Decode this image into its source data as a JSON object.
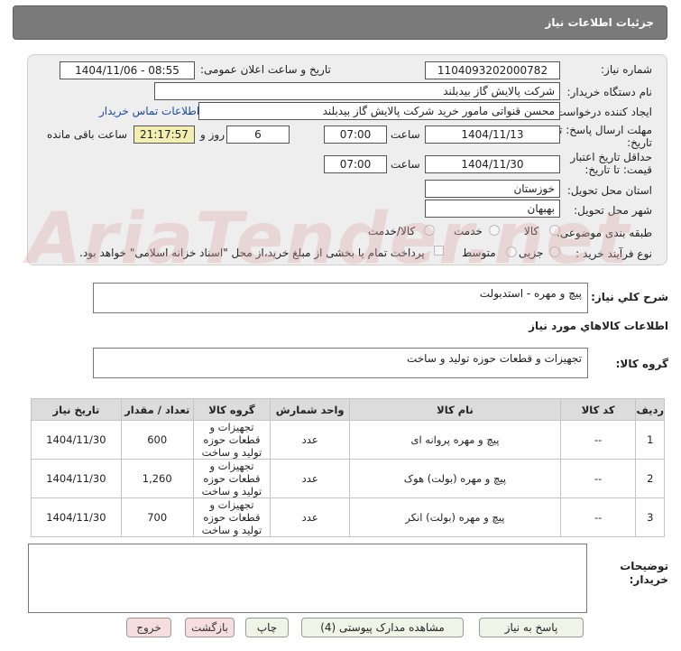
{
  "header": {
    "title": "جزئیات اطلاعات نیاز"
  },
  "form": {
    "need_number_label": "شماره نیاز:",
    "need_number": "1104093202000782",
    "announce_label": "تاریخ و ساعت اعلان عمومی:",
    "announce_value": "1404/11/06 - 08:55",
    "buyer_org_label": "نام دستگاه خریدار:",
    "buyer_org": "شرکت پالایش گاز بیدبلند",
    "creator_label": "ایجاد کننده درخواست:",
    "creator": "محسن قنواتی مامور خرید شرکت پالایش گاز بیدبلند",
    "contact_link": "اطلاعات تماس خریدار",
    "deadline_label_1": "مهلت ارسال پاسخ: تا",
    "deadline_label_2": "تاریخ:",
    "deadline_date": "1404/11/13",
    "time_label": "ساعت",
    "deadline_time": "07:00",
    "days_value": "6",
    "days_label": "روز و",
    "remaining_time": "21:17:57",
    "remaining_label": "ساعت باقی مانده",
    "validity_label_1": "حداقل تاریخ اعتبار",
    "validity_label_2": "قیمت: تا تاریخ:",
    "validity_date": "1404/11/30",
    "validity_time": "07:00",
    "province_label": "استان محل تحویل:",
    "province": "خوزستان",
    "city_label": "شهر محل تحویل:",
    "city": "بهبهان",
    "category_label": "طبقه بندی موضوعی:",
    "category_options": [
      "کالا",
      "خدمت",
      "کالا/خدمت"
    ],
    "process_label": "نوع فرآیند خرید :",
    "process_options": [
      "جزیی",
      "متوسط"
    ],
    "payment_note": "پرداخت تمام یا بخشی از مبلغ خرید،از محل \"اسناد خزانه اسلامی\" خواهد بود."
  },
  "description": {
    "label": "شرح کلي نياز:",
    "value": "پیچ و مهره - استدبولت"
  },
  "goods_info": {
    "title": "اطلاعات کالاهاي مورد نياز"
  },
  "goods_group": {
    "label": "گروه کالا:",
    "value": "تجهیزات و قطعات حوزه تولید و ساخت"
  },
  "table": {
    "headers": [
      "ردیف",
      "کد کالا",
      "نام کالا",
      "واحد شمارش",
      "گروه کالا",
      "تعداد / مقدار",
      "تاریخ نیاز"
    ],
    "rows": [
      {
        "idx": "1",
        "code": "--",
        "name": "پیچ و مهره پروانه ای",
        "unit": "عدد",
        "group": "تجهیزات و قطعات حوزه تولید و ساخت",
        "qty": "600",
        "date": "1404/11/30"
      },
      {
        "idx": "2",
        "code": "--",
        "name": "پیچ و مهره (بولت) هوک",
        "unit": "عدد",
        "group": "تجهیزات و قطعات حوزه تولید و ساخت",
        "qty": "1,260",
        "date": "1404/11/30"
      },
      {
        "idx": "3",
        "code": "--",
        "name": "پیچ و مهره (بولت) انکر",
        "unit": "عدد",
        "group": "تجهیزات و قطعات حوزه تولید و ساخت",
        "qty": "700",
        "date": "1404/11/30"
      }
    ]
  },
  "buyer_notes": {
    "label_1": "توضیحات",
    "label_2": "خریدار:"
  },
  "buttons": {
    "reply": "پاسخ به نیاز",
    "attachments": "مشاهده مدارک پیوستی (4)",
    "print": "چاپ",
    "back": "بازگشت",
    "exit": "خروج"
  },
  "watermark": "AriaTender.net",
  "colors": {
    "header_bg": "#7a7a7a",
    "panel_bg": "#eeeeee",
    "highlight": "#f3efb0",
    "link": "#1a4aa8",
    "button_green": "#eef5e6",
    "button_red": "#f7dede"
  }
}
